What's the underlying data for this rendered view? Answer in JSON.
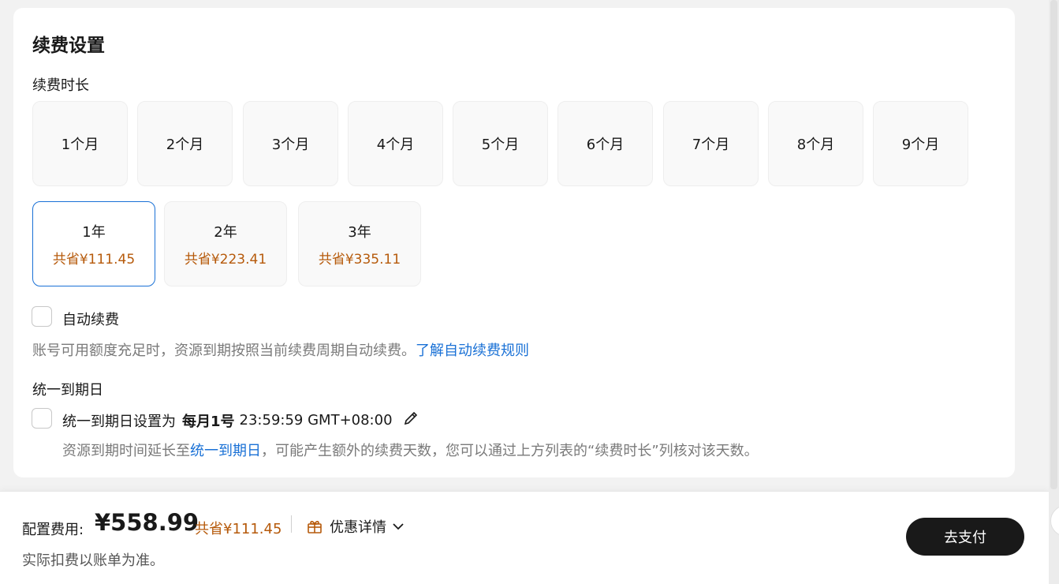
{
  "renewal": {
    "title": "续费设置",
    "duration_label": "续费时长",
    "months": [
      "1个月",
      "2个月",
      "3个月",
      "4个月",
      "5个月",
      "6个月",
      "7个月",
      "8个月",
      "9个月"
    ],
    "years": [
      {
        "label": "1年",
        "save": "共省¥111.45",
        "selected": true
      },
      {
        "label": "2年",
        "save": "共省¥223.41",
        "selected": false
      },
      {
        "label": "3年",
        "save": "共省¥335.11",
        "selected": false
      }
    ],
    "auto_renew": {
      "label": "自动续费",
      "hint": "账号可用额度充足时，资源到期按照当前续费周期自动续费。",
      "link": "了解自动续费规则"
    },
    "unify": {
      "section_label": "统一到期日",
      "prefix": "统一到期日设置为",
      "day": "每月1号",
      "time": "23:59:59 GMT+08:00",
      "hint_prefix": "资源到期时间延长至",
      "hint_link": "统一到期日",
      "hint_suffix": "，可能产生额外的续费天数，您可以通过上方列表的“续费时长”列核对该天数。"
    }
  },
  "footer": {
    "fee_label": "配置费用:",
    "amount": "¥558.99",
    "save": "共省¥111.45",
    "promo_label": "优惠详情",
    "note": "实际扣费以账单为准。",
    "pay_button": "去支付"
  },
  "colors": {
    "accent": "#1a71d6",
    "save": "#b65a0b",
    "primary_button": "#191919"
  }
}
